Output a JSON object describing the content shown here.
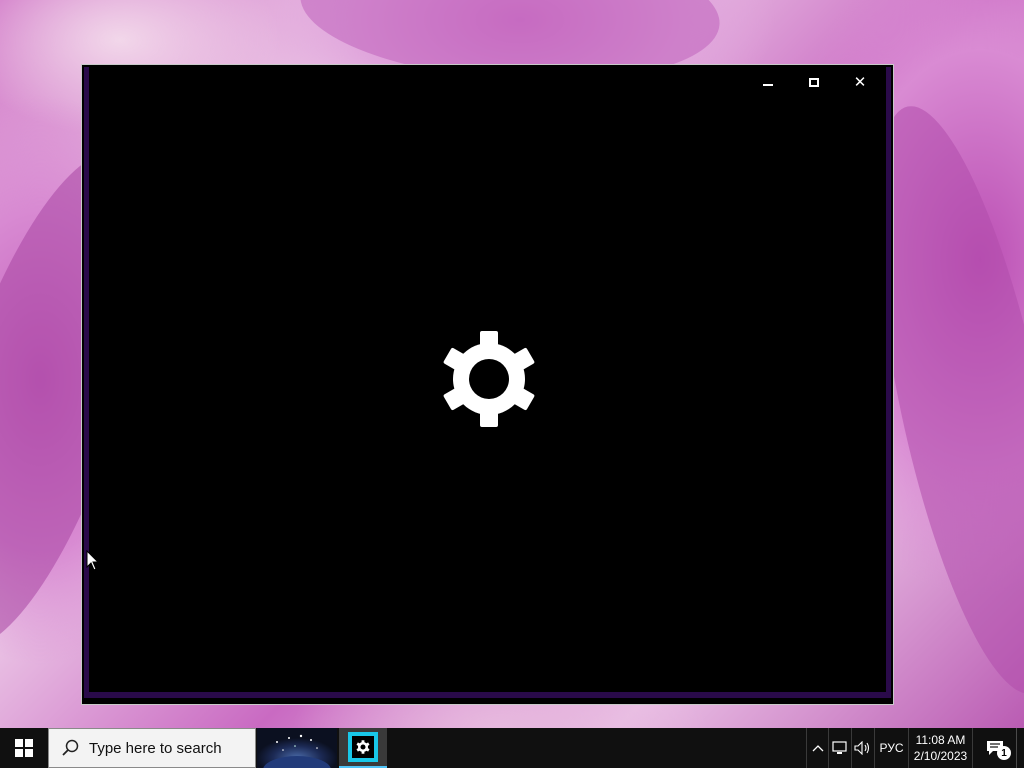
{
  "desktop": {
    "wallpaper": "anime-girl-pink-hair"
  },
  "window": {
    "controls": {
      "minimize_icon": "minimize-icon",
      "maximize_icon": "maximize-icon",
      "close_icon": "close-icon",
      "close_glyph": "✕"
    },
    "content_icon": "gear-icon",
    "background": "#000000",
    "accent_frame": "#2a0a4a"
  },
  "taskbar": {
    "start_icon": "windows-logo-icon",
    "search": {
      "placeholder": "Type here to search",
      "icon": "search-icon"
    },
    "pinned": [
      {
        "name": "wallpaper-app",
        "icon": "starry-sky-icon"
      },
      {
        "name": "settings-app",
        "icon": "gear-icon",
        "active": true,
        "accent": "#18c7e8"
      }
    ],
    "tray": {
      "chevron_icon": "chevron-up-icon",
      "network_icon": "network-icon",
      "volume_icon": "volume-icon",
      "language": "РУС",
      "time": "11:08 AM",
      "date": "2/10/2023",
      "notification_icon": "action-center-icon",
      "notification_count": "1"
    }
  }
}
